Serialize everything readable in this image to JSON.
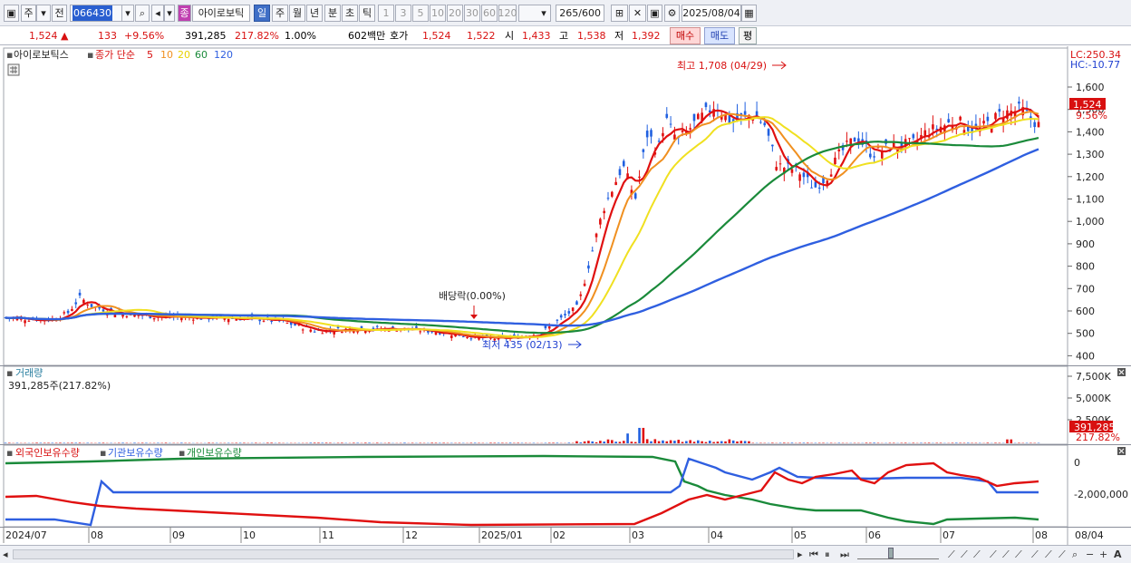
{
  "toolbar": {
    "market": "주",
    "prev": "전",
    "code": "066430",
    "type_badge": "종",
    "stock_name": "아이로보틱",
    "periods": [
      "일",
      "주",
      "월",
      "년",
      "분",
      "초",
      "틱"
    ],
    "active_period": "일",
    "intervals": [
      "1",
      "3",
      "5",
      "10",
      "20",
      "30",
      "60",
      "120"
    ],
    "count": "265",
    "max": "/600",
    "date": "2025/08/04"
  },
  "info": {
    "price": "1,524",
    "change": "133",
    "change_pct": "+9.56%",
    "volume": "391,285",
    "vol_ratio": "217.82%",
    "rate": "1.00%",
    "amount": "602백만",
    "ask_label": "호가",
    "ask1": "1,524",
    "ask2": "1,522",
    "open_label": "시",
    "open": "1,433",
    "high_label": "고",
    "high": "1,538",
    "low_label": "저",
    "low": "1,392",
    "buy": "매수",
    "sell": "매도",
    "avg": "평"
  },
  "legend": {
    "name": "아이로보틱스",
    "ma_label": "종가 단순",
    "ma": [
      "5",
      "10",
      "20",
      "60",
      "120"
    ]
  },
  "annotations": {
    "high": "최고 1,708 (04/29)",
    "low": "최저 435 (02/13)",
    "dividend": "배당락(0.00%)"
  },
  "price_axis": {
    "lc": "LC:250.34",
    "hc": "HC:-10.77",
    "ticks": [
      "1,600",
      "1,500",
      "1,400",
      "1,300",
      "1,200",
      "1,100",
      "1,000",
      "900",
      "800",
      "700",
      "600",
      "500",
      "400"
    ],
    "current": "1,524",
    "current_pct": "9.56%"
  },
  "volume": {
    "title": "거래량",
    "subtitle": "391,285주(217.82%)",
    "ticks": [
      "7,500K",
      "5,000K",
      "2,500K"
    ],
    "current": "391,285",
    "current_pct": "217.82%"
  },
  "holdings": {
    "series": [
      "외국인보유수량",
      "기관보유수량",
      "개인보유수량"
    ],
    "ticks": [
      "0",
      "-2,000,000"
    ]
  },
  "x_axis": {
    "labels": [
      "2024/07",
      "08",
      "09",
      "10",
      "11",
      "12",
      "2025/01",
      "02",
      "03",
      "04",
      "05",
      "06",
      "07",
      "08",
      "08/04"
    ]
  },
  "colors": {
    "red": "#e01010",
    "blue": "#2f5fe0",
    "green": "#20a020",
    "darkgreen": "#1a8a3a",
    "yellow": "#f0e020",
    "orange": "#f09020",
    "up": "#e01010",
    "down": "#2060e0"
  }
}
